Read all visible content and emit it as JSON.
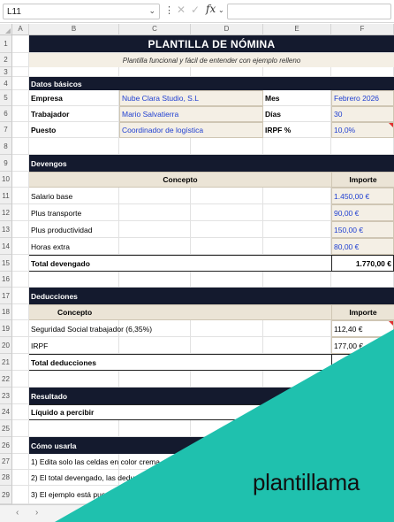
{
  "formula_bar": {
    "cell_ref": "L11",
    "fx_label": "fx"
  },
  "columns": [
    "A",
    "B",
    "C",
    "D",
    "E",
    "F"
  ],
  "rows": [
    "1",
    "2",
    "3",
    "4",
    "5",
    "6",
    "7",
    "8",
    "9",
    "10",
    "11",
    "12",
    "13",
    "14",
    "15",
    "16",
    "17",
    "18",
    "19",
    "20",
    "21",
    "22",
    "23",
    "24",
    "25",
    "26",
    "27",
    "28",
    "29"
  ],
  "sheet": {
    "title": "PLANTILLA DE NÓMINA",
    "subtitle": "Plantilla funcional y fácil de entender con ejemplo relleno",
    "datos": {
      "header": "Datos básicos",
      "empresa_label": "Empresa",
      "empresa_value": "Nube Clara Studio, S.L",
      "trabajador_label": "Trabajador",
      "trabajador_value": "Mario Salvatierra",
      "puesto_label": "Puesto",
      "puesto_value": "Coordinador de logística",
      "mes_label": "Mes",
      "mes_value": "Febrero 2026",
      "dias_label": "Días",
      "dias_value": "30",
      "irpf_label": "IRPF %",
      "irpf_value": "10,0%"
    },
    "devengos": {
      "header": "Devengos",
      "col_concepto": "Concepto",
      "col_importe": "Importe",
      "items": [
        {
          "concepto": "Salario base",
          "importe": "1.450,00 €"
        },
        {
          "concepto": "Plus transporte",
          "importe": "90,00 €"
        },
        {
          "concepto": "Plus productividad",
          "importe": "150,00 €"
        },
        {
          "concepto": "Horas extra",
          "importe": "80,00 €"
        }
      ],
      "total_label": "Total devengado",
      "total_value": "1.770,00 €"
    },
    "deducciones": {
      "header": "Deducciones",
      "col_concepto": "Concepto",
      "col_importe": "Importe",
      "items": [
        {
          "concepto": "Seguridad Social trabajador (6,35%)",
          "importe": "112,40 €"
        },
        {
          "concepto": "IRPF",
          "importe": "177,00 €"
        }
      ],
      "total_label": "Total deducciones"
    },
    "resultado": {
      "header": "Resultado",
      "liquido_label": "Líquido a percibir"
    },
    "como": {
      "header": "Cómo usarla",
      "steps": [
        "1) Edita solo las celdas en color crema.",
        "2) El total devengado, las deducci",
        "3) El ejemplo está puesto"
      ]
    }
  },
  "brand": "plantillama",
  "colors": {
    "navy": "#141a2e",
    "cream": "#f4efe5",
    "teal": "#1fc1ae",
    "value_blue": "#1f3fd1"
  }
}
